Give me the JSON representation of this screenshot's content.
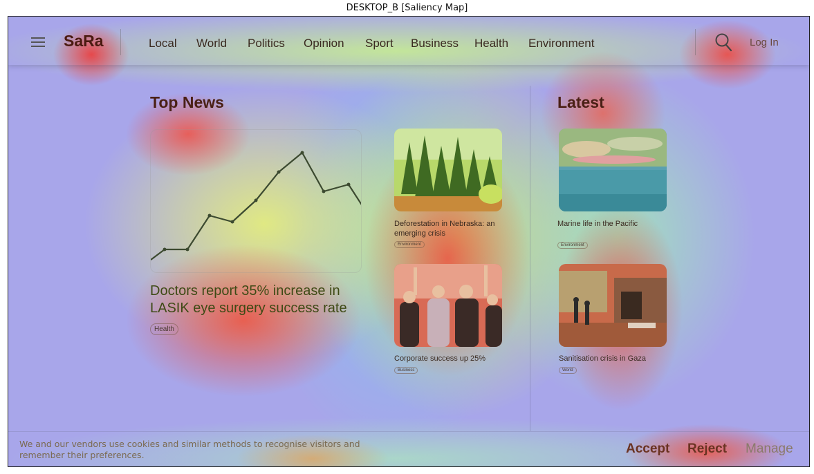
{
  "figure_title": "DESKTOP_B [Saliency Map]",
  "header": {
    "logo": "SaRa",
    "nav": [
      "Local",
      "World",
      "Politics",
      "Opinion",
      "Sport",
      "Business",
      "Health",
      "Environment"
    ],
    "login": "Log In",
    "icons": [
      "hamburger-menu-icon",
      "search-icon"
    ]
  },
  "top_news": {
    "title": "Top News",
    "headline": "Doctors report 35% increase in LASIK eye surgery success rate",
    "tag": "Health",
    "side_articles": [
      {
        "caption": "Deforestation in Nebraska: an emerging crisis",
        "tag": "Environment",
        "image": "forest"
      },
      {
        "caption": "Corporate success up 25%",
        "tag": "Business",
        "image": "celebrating-people"
      }
    ]
  },
  "latest": {
    "title": "Latest",
    "articles": [
      {
        "caption": "Marine life in the Pacific",
        "tag": "Environment",
        "image": "ocean"
      },
      {
        "caption": "Sanitisation crisis in Gaza",
        "tag": "World",
        "image": "street-scene"
      }
    ]
  },
  "cookie_bar": {
    "text": "We and our vendors use cookies and similar methods to recognise visitors and remember their preferences.",
    "accept": "Accept",
    "reject": "Reject",
    "manage": "Manage"
  },
  "colors": {
    "accept": "#6a3322",
    "reject": "#6a3322",
    "manage": "#8a7a6a"
  }
}
